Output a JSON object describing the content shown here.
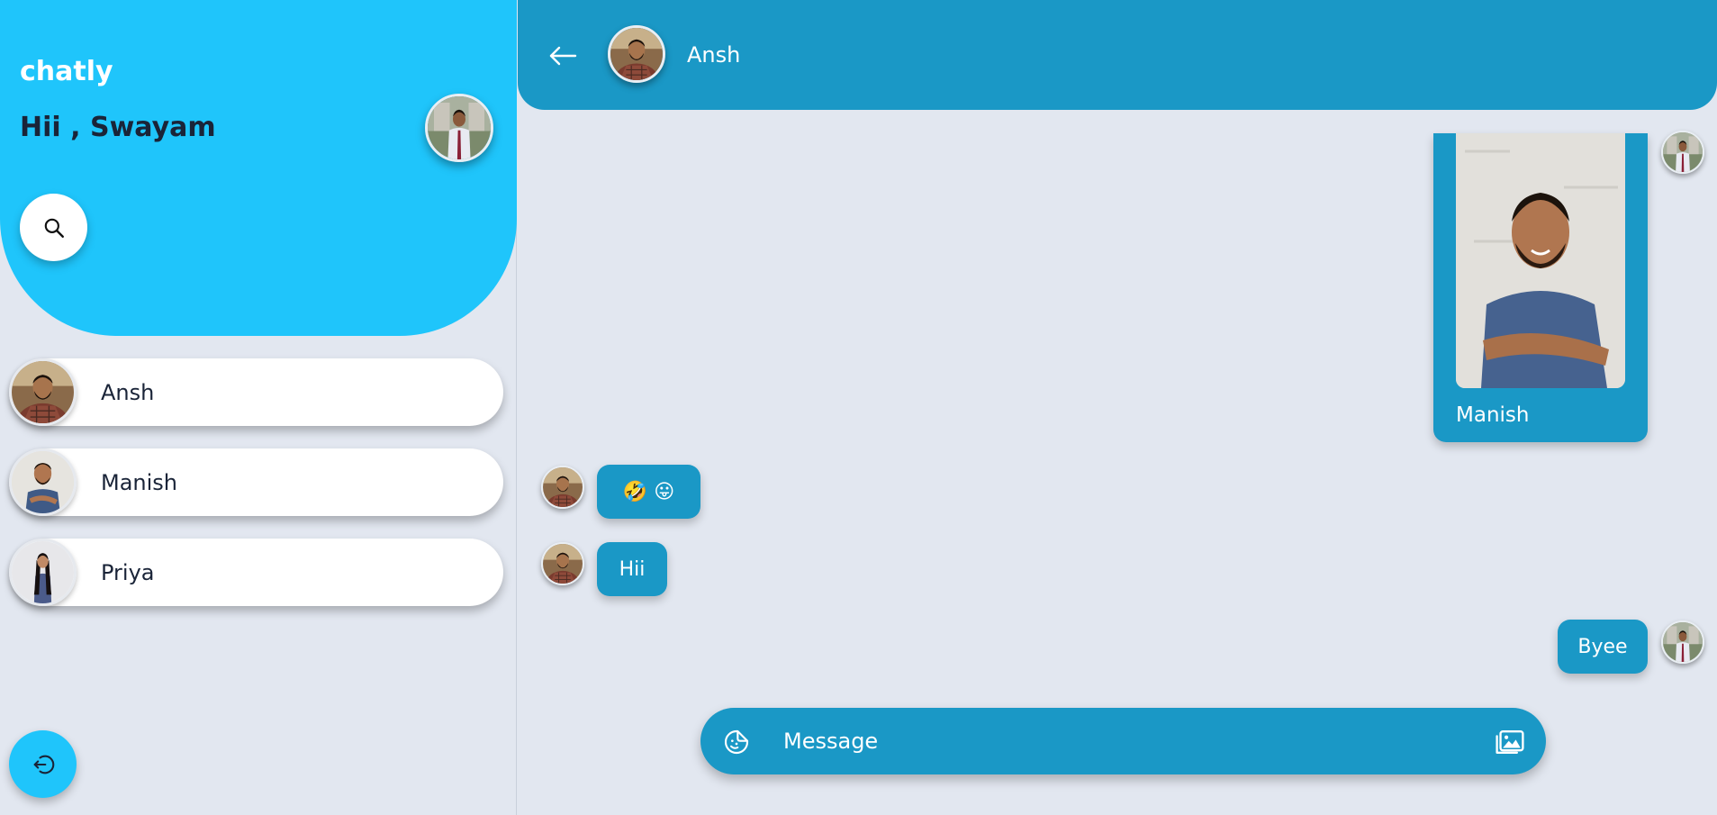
{
  "sidebar": {
    "app_name": "chatly",
    "greeting": "Hii , Swayam",
    "contacts": [
      {
        "name": "Ansh"
      },
      {
        "name": "Manish"
      },
      {
        "name": "Priya"
      }
    ]
  },
  "chat": {
    "header": {
      "name": "Ansh"
    },
    "messages": [
      {
        "type": "image",
        "caption": "Manish",
        "sender": "me"
      },
      {
        "type": "text",
        "text": "🤣 😛",
        "sender": "Ansh"
      },
      {
        "type": "text",
        "text": "Hii",
        "sender": "Ansh"
      },
      {
        "type": "text",
        "text": "Byee",
        "sender": "me"
      }
    ],
    "composer": {
      "placeholder": "Message"
    }
  },
  "icons": {
    "search": "search-icon",
    "logout": "logout-icon",
    "back": "arrow-left-icon",
    "sticker": "sticker-icon",
    "gallery": "image-icon"
  },
  "colors": {
    "header_accent": "#1fc5fb",
    "chat_accent": "#1a98c6",
    "background": "#e2e7f0"
  }
}
